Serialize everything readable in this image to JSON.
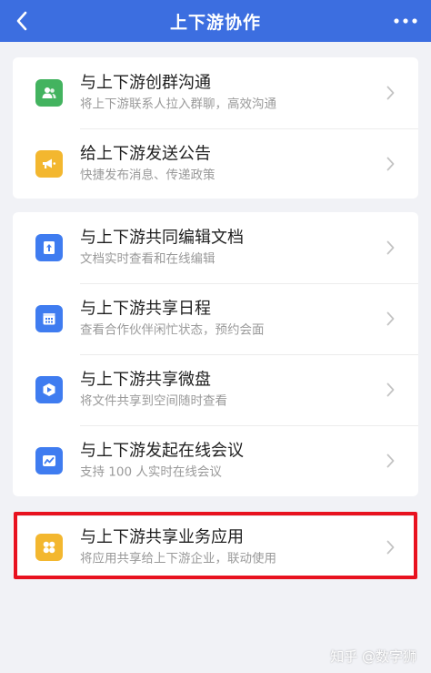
{
  "header": {
    "title": "上下游协作",
    "back_icon": "chevron-left-icon",
    "more_icon": "more-dots-icon",
    "bg_color": "#3c6ee0"
  },
  "group1": [
    {
      "title": "与上下游创群沟通",
      "subtitle": "将上下游联系人拉入群聊，高效沟通",
      "icon": "group-chat-icon",
      "icon_color": "#43b35f"
    },
    {
      "title": "给上下游发送公告",
      "subtitle": "快捷发布消息、传递政策",
      "icon": "announcement-icon",
      "icon_color": "#f3b72f"
    }
  ],
  "group2": [
    {
      "title": "与上下游共同编辑文档",
      "subtitle": "文档实时查看和在线编辑",
      "icon": "document-icon",
      "icon_color": "#3f7cf0"
    },
    {
      "title": "与上下游共享日程",
      "subtitle": "查看合作伙伴闲忙状态，预约会面",
      "icon": "calendar-icon",
      "icon_color": "#3f7cf0"
    },
    {
      "title": "与上下游共享微盘",
      "subtitle": "将文件共享到空间随时查看",
      "icon": "cloud-drive-icon",
      "icon_color": "#3f7cf0"
    },
    {
      "title": "与上下游发起在线会议",
      "subtitle": "支持 100 人实时在线会议",
      "icon": "meeting-icon",
      "icon_color": "#3f7cf0"
    }
  ],
  "group3": [
    {
      "title": "与上下游共享业务应用",
      "subtitle": "将应用共享给上下游企业，联动使用",
      "icon": "apps-icon",
      "icon_color": "#f3b72f"
    }
  ],
  "highlight_color": "#e8121f",
  "watermark": "知乎 @数字狮"
}
